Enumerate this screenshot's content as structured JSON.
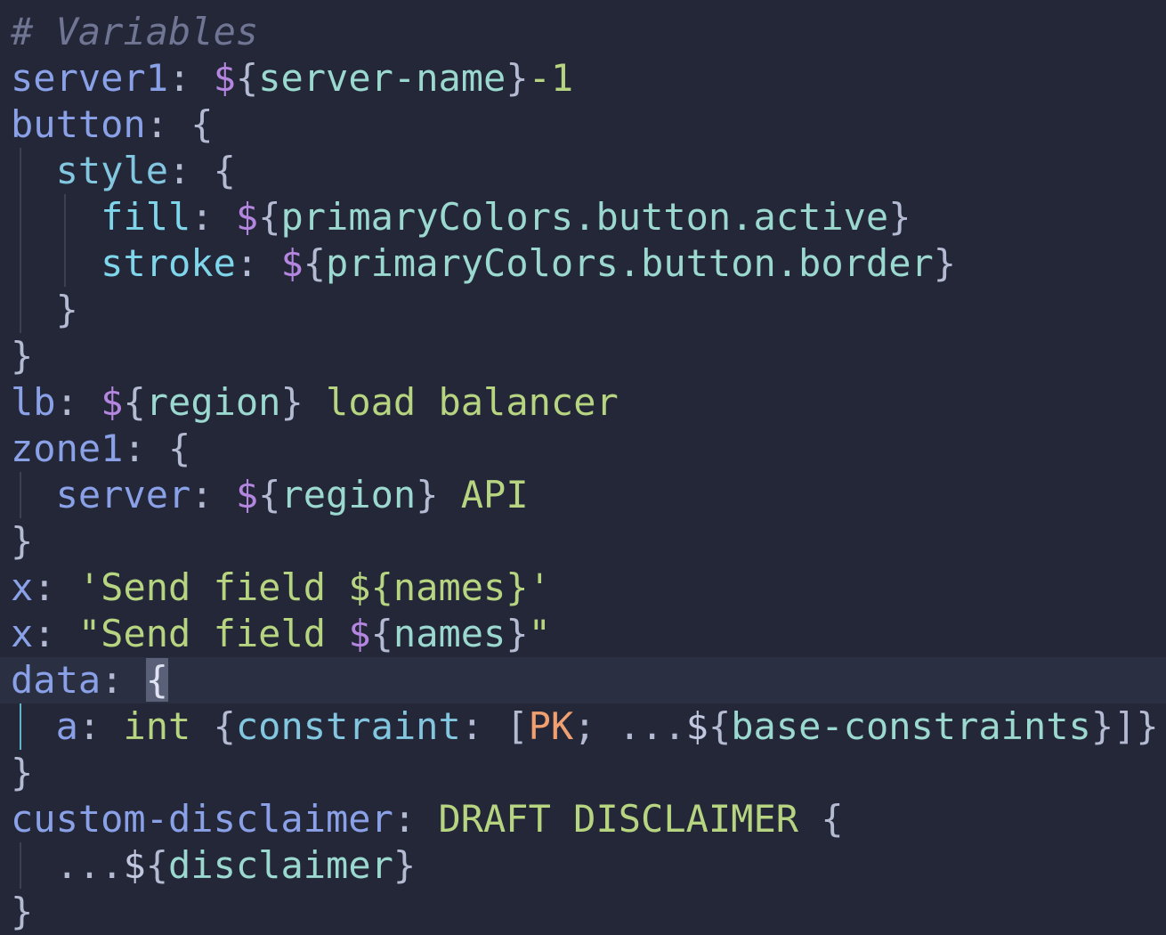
{
  "editor": {
    "lines": [
      {
        "guides": [],
        "tokens": [
          {
            "t": "# Variables",
            "c": "comment"
          }
        ]
      },
      {
        "guides": [],
        "tokens": [
          {
            "t": "server1",
            "c": "key1"
          },
          {
            "t": ": ",
            "c": "punct"
          },
          {
            "t": "$",
            "c": "dollar"
          },
          {
            "t": "{",
            "c": "punct"
          },
          {
            "t": "server-name",
            "c": "var"
          },
          {
            "t": "}",
            "c": "punct"
          },
          {
            "t": "-1",
            "c": "num"
          }
        ]
      },
      {
        "guides": [],
        "tokens": [
          {
            "t": "button",
            "c": "key1"
          },
          {
            "t": ": {",
            "c": "punct"
          }
        ]
      },
      {
        "guides": [
          22
        ],
        "tokens": [
          {
            "t": "  ",
            "c": "plain"
          },
          {
            "t": "style",
            "c": "key2"
          },
          {
            "t": ": {",
            "c": "punct"
          }
        ]
      },
      {
        "guides": [
          22,
          72
        ],
        "tokens": [
          {
            "t": "    ",
            "c": "plain"
          },
          {
            "t": "fill",
            "c": "key3"
          },
          {
            "t": ": ",
            "c": "punct"
          },
          {
            "t": "$",
            "c": "dollar"
          },
          {
            "t": "{",
            "c": "punct"
          },
          {
            "t": "primaryColors.button.active",
            "c": "var"
          },
          {
            "t": "}",
            "c": "punct"
          }
        ]
      },
      {
        "guides": [
          22,
          72
        ],
        "tokens": [
          {
            "t": "    ",
            "c": "plain"
          },
          {
            "t": "stroke",
            "c": "key3"
          },
          {
            "t": ": ",
            "c": "punct"
          },
          {
            "t": "$",
            "c": "dollar"
          },
          {
            "t": "{",
            "c": "punct"
          },
          {
            "t": "primaryColors.button.border",
            "c": "var"
          },
          {
            "t": "}",
            "c": "punct"
          }
        ]
      },
      {
        "guides": [
          22
        ],
        "tokens": [
          {
            "t": "  ",
            "c": "plain"
          },
          {
            "t": "}",
            "c": "punct"
          }
        ]
      },
      {
        "guides": [],
        "tokens": [
          {
            "t": "}",
            "c": "punct"
          }
        ]
      },
      {
        "guides": [],
        "tokens": [
          {
            "t": "lb",
            "c": "key1"
          },
          {
            "t": ": ",
            "c": "punct"
          },
          {
            "t": "$",
            "c": "dollar"
          },
          {
            "t": "{",
            "c": "punct"
          },
          {
            "t": "region",
            "c": "var"
          },
          {
            "t": "}",
            "c": "punct"
          },
          {
            "t": " load balancer",
            "c": "str"
          }
        ]
      },
      {
        "guides": [],
        "tokens": [
          {
            "t": "zone1",
            "c": "key1"
          },
          {
            "t": ": {",
            "c": "punct"
          }
        ]
      },
      {
        "guides": [
          22
        ],
        "tokens": [
          {
            "t": "  ",
            "c": "plain"
          },
          {
            "t": "server",
            "c": "key1"
          },
          {
            "t": ": ",
            "c": "punct"
          },
          {
            "t": "$",
            "c": "dollar"
          },
          {
            "t": "{",
            "c": "punct"
          },
          {
            "t": "region",
            "c": "var"
          },
          {
            "t": "}",
            "c": "punct"
          },
          {
            "t": " API",
            "c": "str"
          }
        ]
      },
      {
        "guides": [],
        "tokens": [
          {
            "t": "}",
            "c": "punct"
          }
        ]
      },
      {
        "guides": [],
        "tokens": [
          {
            "t": "x",
            "c": "key1"
          },
          {
            "t": ": ",
            "c": "punct"
          },
          {
            "t": "'Send field ${names}'",
            "c": "str"
          }
        ]
      },
      {
        "guides": [],
        "tokens": [
          {
            "t": "x",
            "c": "key1"
          },
          {
            "t": ": ",
            "c": "punct"
          },
          {
            "t": "\"Send field ",
            "c": "str"
          },
          {
            "t": "$",
            "c": "dollar"
          },
          {
            "t": "{",
            "c": "punct"
          },
          {
            "t": "names",
            "c": "var"
          },
          {
            "t": "}",
            "c": "punct"
          },
          {
            "t": "\"",
            "c": "str"
          }
        ]
      },
      {
        "guides": [],
        "current": true,
        "tokens": [
          {
            "t": "data",
            "c": "key1"
          },
          {
            "t": ": ",
            "c": "punct"
          },
          {
            "t": "{",
            "c": "brace-hl"
          }
        ]
      },
      {
        "guides": [
          22
        ],
        "active_guide": true,
        "tokens": [
          {
            "t": "  ",
            "c": "plain"
          },
          {
            "t": "a",
            "c": "key1"
          },
          {
            "t": ": ",
            "c": "punct"
          },
          {
            "t": "int",
            "c": "type"
          },
          {
            "t": " {",
            "c": "punct"
          },
          {
            "t": "constraint",
            "c": "key2"
          },
          {
            "t": ": [",
            "c": "punct"
          },
          {
            "t": "PK",
            "c": "pk"
          },
          {
            "t": "; ...",
            "c": "punct"
          },
          {
            "t": "$",
            "c": "plain"
          },
          {
            "t": "{",
            "c": "punct"
          },
          {
            "t": "base-constraints",
            "c": "var"
          },
          {
            "t": "}]}",
            "c": "punct"
          }
        ]
      },
      {
        "guides": [],
        "tokens": [
          {
            "t": "}",
            "c": "punct"
          }
        ]
      },
      {
        "guides": [],
        "tokens": [
          {
            "t": "custom-disclaimer",
            "c": "key1"
          },
          {
            "t": ": ",
            "c": "punct"
          },
          {
            "t": "DRAFT DISCLAIMER",
            "c": "str"
          },
          {
            "t": " {",
            "c": "punct"
          }
        ]
      },
      {
        "guides": [
          22
        ],
        "tokens": [
          {
            "t": "  ",
            "c": "plain"
          },
          {
            "t": "...",
            "c": "punct"
          },
          {
            "t": "$",
            "c": "plain"
          },
          {
            "t": "{",
            "c": "punct"
          },
          {
            "t": "disclaimer",
            "c": "var"
          },
          {
            "t": "}",
            "c": "punct"
          }
        ]
      },
      {
        "guides": [],
        "tokens": [
          {
            "t": "}",
            "c": "punct"
          }
        ]
      }
    ]
  }
}
